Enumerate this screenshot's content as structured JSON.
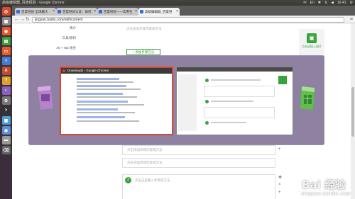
{
  "os": {
    "window_title": "高级编辑器_百度经验 - Google Chrome",
    "tray_time": "16:41",
    "tray_lang": "En"
  },
  "browser": {
    "tabs": [
      {
        "label": "百度经验-全球最大"
      },
      {
        "label": "百度经验认证：如何"
      },
      {
        "label": "百度经验——实用生"
      },
      {
        "label": "高级编辑器_百度经"
      }
    ],
    "url": "jingyan.baidu.com/edit/content"
  },
  "page": {
    "sidenav": [
      "简介",
      "工具/原料",
      "Alt + Tab 组合"
    ],
    "top_placeholder": "点击添加步骤内容或方法",
    "add_step_button": "+ 添加步骤方法",
    "insert_image_label": "点击这插入图片",
    "line1_placeholder": "点击添加步骤内容或方法",
    "line2_placeholder": "点击添加步骤内容或方法",
    "step3_number": "3",
    "step3_placeholder": "点击这里输入步骤或方法"
  },
  "switcher": {
    "window1_title": "Downloads - Google Chrome"
  },
  "watermark": {
    "main": "Bai 经验",
    "sub": "jingyan.baidu.com"
  },
  "colors": {
    "accent_green": "#3aa23a",
    "switcher_selected_border": "#d9472e",
    "launcher_bg": "#3b2e3a"
  }
}
